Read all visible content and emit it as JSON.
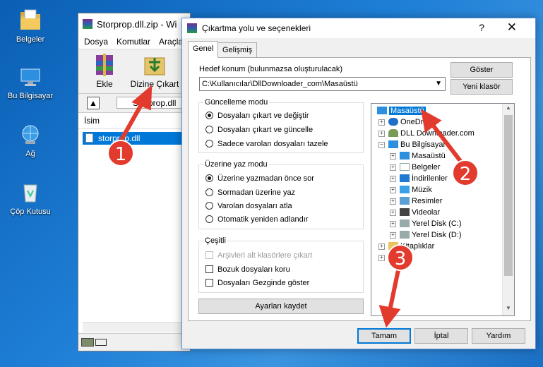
{
  "desktop": {
    "icons": [
      {
        "label": "Belgeler",
        "icon": "folder-documents-icon"
      },
      {
        "label": "Bu Bilgisayar",
        "icon": "computer-icon"
      },
      {
        "label": "Ağ",
        "icon": "network-icon"
      },
      {
        "label": "Çöp Kutusu",
        "icon": "recycle-bin-icon"
      }
    ]
  },
  "winrar": {
    "title": "Storprop.dll.zip - Wi",
    "menu": [
      "Dosya",
      "Komutlar",
      "Araçla"
    ],
    "toolbar": {
      "add_label": "Ekle",
      "extract_label": "Dizine Çıkart"
    },
    "address": "Storprop.dll",
    "list_header": "İsim",
    "file_name": "storprop.dll"
  },
  "dialog": {
    "title": "Çıkartma yolu ve seçenekleri",
    "help": "?",
    "close": "✕",
    "tabs": [
      "Genel",
      "Gelişmiş"
    ],
    "dest_label": "Hedef konum (bulunmazsa oluşturulacak)",
    "dest_value": "C:\\Kullanıcılar\\DllDownloader_com\\Masaüstü",
    "show_button": "Göster",
    "new_folder_button": "Yeni klasör",
    "update_mode": {
      "title": "Güncelleme modu",
      "options": [
        "Dosyaları çıkart ve değiştir",
        "Dosyaları çıkart ve güncelle",
        "Sadece varolan dosyaları tazele"
      ],
      "selected": 0
    },
    "overwrite_mode": {
      "title": "Üzerine yaz modu",
      "options": [
        "Üzerine yazmadan önce sor",
        "Sormadan üzerine yaz",
        "Varolan dosyaları atla",
        "Otomatik yeniden adlandır"
      ],
      "selected": 0
    },
    "misc": {
      "title": "Çeşitli",
      "options": [
        "Arşivleri alt klasörlere çıkart",
        "Bozuk dosyaları koru",
        "Dosyaları Gezginde göster"
      ]
    },
    "save_settings_button": "Ayarları kaydet",
    "tree": {
      "nodes": [
        {
          "label": "Masaüstü",
          "selected": true
        },
        {
          "label": "OneDrive"
        },
        {
          "label": "DLL Downloader.com"
        },
        {
          "label": "Bu Bilgisayar"
        },
        {
          "label": "Masaüstü"
        },
        {
          "label": "Belgeler"
        },
        {
          "label": "İndirilenler"
        },
        {
          "label": "Müzik"
        },
        {
          "label": "Resimler"
        },
        {
          "label": "Videolar"
        },
        {
          "label": "Yerel Disk (C:)"
        },
        {
          "label": "Yerel Disk (D:)"
        },
        {
          "label": "Kitaplıklar"
        }
      ]
    },
    "ok_button": "Tamam",
    "cancel_button": "İptal",
    "help_button": "Yardım"
  },
  "annotations": [
    "1",
    "2",
    "3"
  ],
  "colors": {
    "accent": "#0078d7",
    "annotation": "#e23b2e"
  }
}
